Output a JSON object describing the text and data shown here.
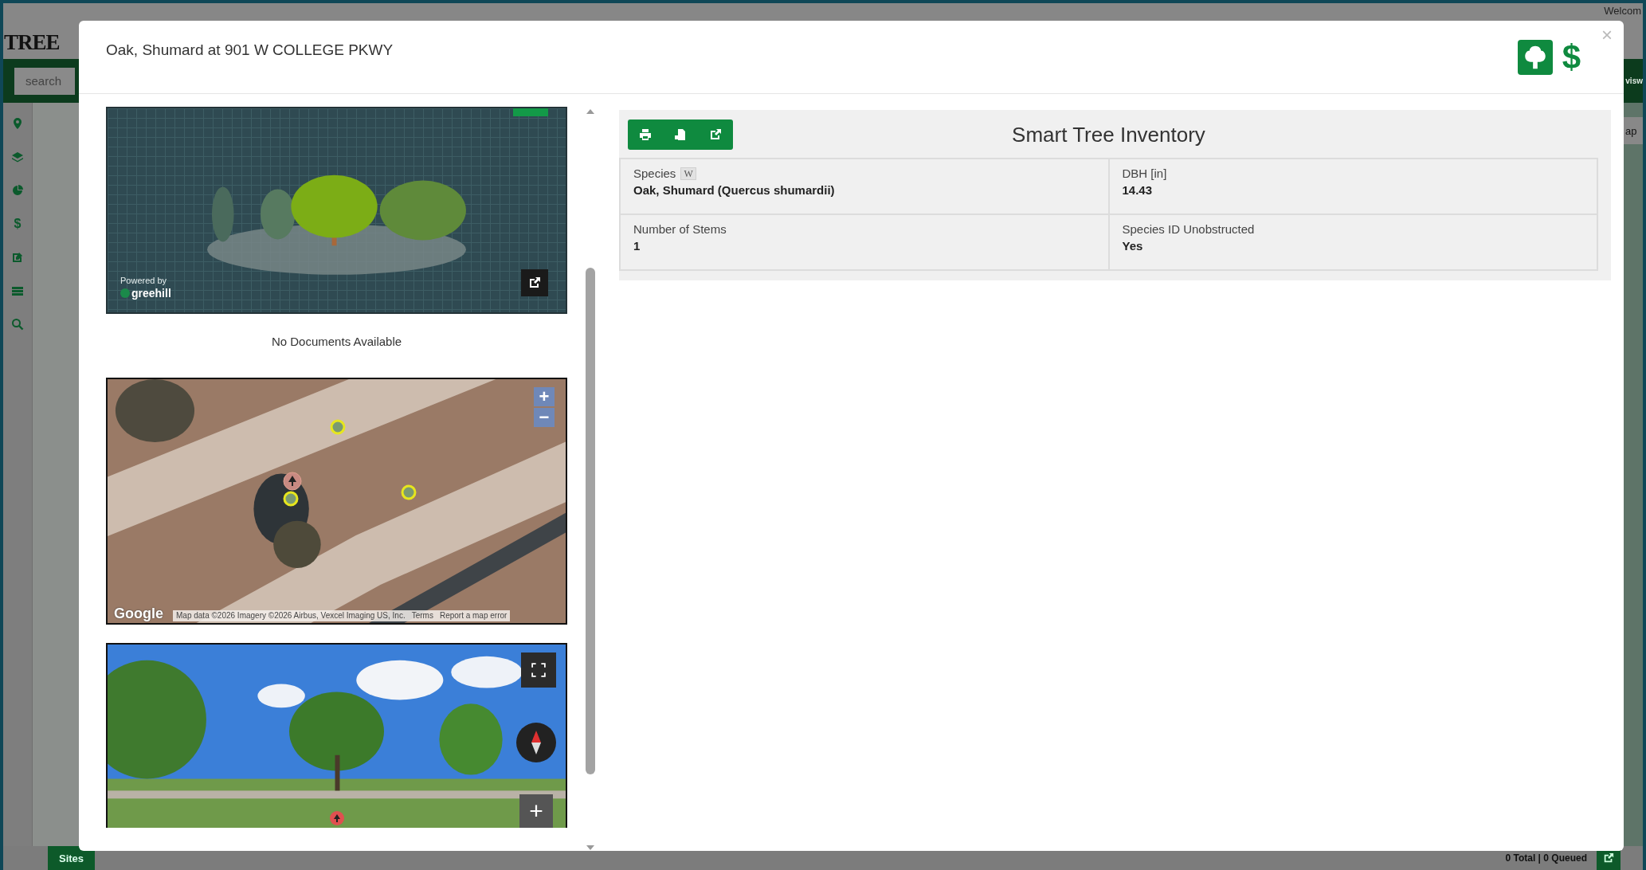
{
  "app": {
    "logo": "TREE",
    "welcome": "Welcom",
    "search": {
      "placeholder": "search"
    },
    "nav_tab": "visw",
    "map_button": "ap",
    "sidebar_icons": [
      {
        "kind": "pin"
      },
      {
        "kind": "layers"
      },
      {
        "kind": "pie"
      },
      {
        "kind": "glyph",
        "glyph": "$"
      },
      {
        "kind": "edit"
      },
      {
        "kind": "table"
      },
      {
        "kind": "search"
      }
    ],
    "bottom_bar": {
      "tab": "Sites",
      "status": "0 Total | 0 Queued"
    }
  },
  "modal": {
    "title": "Oak, Shumard at 901 W COLLEGE PKWY",
    "close": "×",
    "header_icons": [
      {
        "kind": "tree"
      },
      {
        "kind": "glyph",
        "glyph": "$"
      }
    ],
    "viewer": {
      "powered_by": "Powered by",
      "brand": "greehill"
    },
    "documents_message": "No Documents Available",
    "map": {
      "zoom_in": "+",
      "zoom_out": "−",
      "logo": "Google",
      "attribution": "Map data ©2026 Imagery ©2026 Airbus, Vexcel Imaging US, Inc.",
      "links": [
        "Terms",
        "Report a map error"
      ]
    },
    "street_view": {
      "zoom_in": "+"
    },
    "inventory": {
      "title": "Smart Tree Inventory",
      "toolbar": [
        {
          "kind": "print"
        },
        {
          "kind": "document"
        },
        {
          "kind": "external"
        }
      ],
      "fields": [
        {
          "label": "Species",
          "badge": "W",
          "value": "Oak, Shumard (Quercus shumardii)"
        },
        {
          "label": "DBH [in]",
          "value": "14.43"
        },
        {
          "label": "Number of Stems",
          "value": "1"
        },
        {
          "label": "Species ID Unobstructed",
          "value": "Yes"
        }
      ]
    }
  }
}
